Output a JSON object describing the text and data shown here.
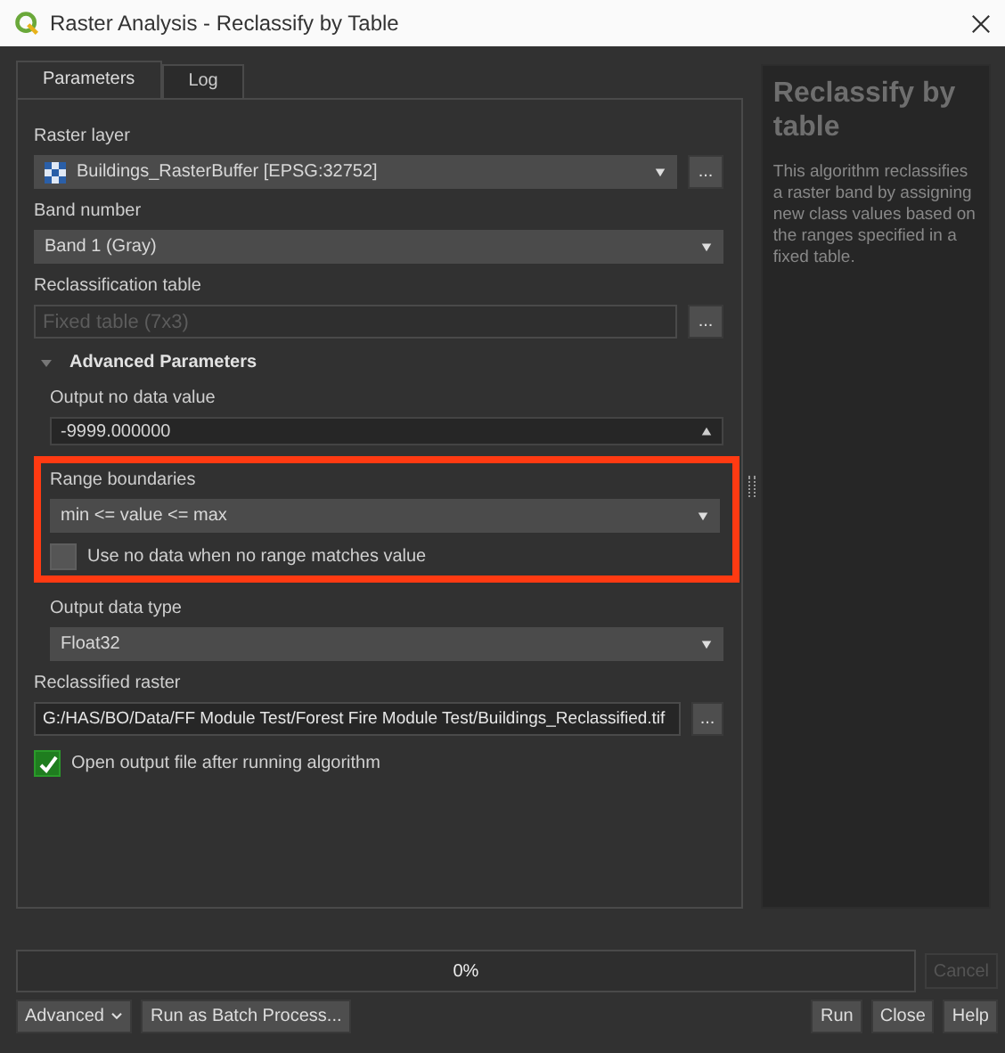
{
  "window": {
    "title": "Raster Analysis - Reclassify by Table"
  },
  "tabs": [
    {
      "label": "Parameters",
      "selected": true
    },
    {
      "label": "Log",
      "selected": false
    }
  ],
  "params": [
    {
      "kind": "layer",
      "label": "Raster layer",
      "value": "Buildings_RasterBuffer [EPSG:32752]",
      "button": "..."
    },
    {
      "kind": "combo",
      "label": "Band number",
      "value": "Band 1 (Gray)"
    },
    {
      "kind": "table",
      "label": "Reclassification table",
      "placeholder": "Fixed table (7x3)",
      "button": "..."
    },
    {
      "kind": "section",
      "label": "Advanced Parameters",
      "expanded": true,
      "children": [
        {
          "kind": "number",
          "label": "Output no data value",
          "value": "-9999.000000",
          "highlighted": false
        },
        {
          "kind": "combo",
          "label": "Range boundaries",
          "value": "min <= value <= max",
          "highlighted": true
        },
        {
          "kind": "checkbox",
          "label": "Use no data when no range matches value",
          "checked": false,
          "highlighted": true
        },
        {
          "kind": "combo",
          "label": "Output data type",
          "value": "Float32",
          "highlighted": false
        }
      ]
    },
    {
      "kind": "file",
      "label": "Reclassified raster",
      "value": "G:/HAS/BO/Data/FF Module Test/Forest Fire Module Test/Buildings_Reclassified.tif",
      "button": "..."
    },
    {
      "kind": "checkbox",
      "label": "Open output file after running algorithm",
      "checked": true
    }
  ],
  "help": {
    "title": "Reclassify by table",
    "text": "This algorithm reclassifies a raster band by assigning new class values based on the ranges specified in a fixed table."
  },
  "progress": {
    "level": 0,
    "text": "0%"
  },
  "cancel": {
    "label": "Cancel",
    "disabled": true
  },
  "left_buttons": [
    {
      "label": "Advanced",
      "menu": true
    },
    {
      "label": "Run as Batch Process...",
      "menu": false
    }
  ],
  "right_buttons": [
    {
      "label": "Run"
    },
    {
      "label": "Close"
    },
    {
      "label": "Help"
    }
  ]
}
